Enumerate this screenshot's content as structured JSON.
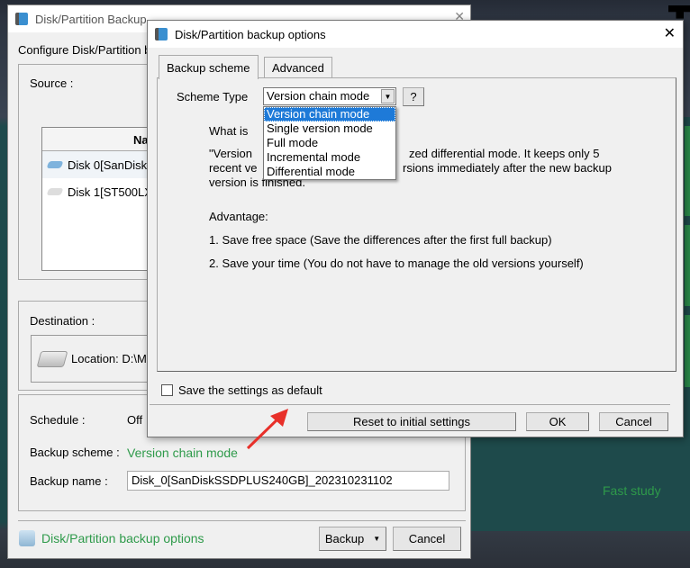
{
  "background": {
    "right_text": "Fast study"
  },
  "main_window": {
    "title": "Disk/Partition Backup",
    "configure_label": "Configure Disk/Partition b",
    "source_label": "Source :",
    "list_header": "Na",
    "disks": [
      {
        "name": "Disk 0[SanDisk",
        "icon": "ssd-icon",
        "color": "#7fb3dd"
      },
      {
        "name": "Disk 1[ST500LX",
        "icon": "hdd-icon",
        "color": "#dddddd"
      }
    ],
    "destination_label": "Destination :",
    "location_text": "Location: D:\\MC",
    "schedule_label": "Schedule :",
    "schedule_value": "Off",
    "scheme_label": "Backup scheme :",
    "scheme_value": "Version chain mode",
    "name_label": "Backup name :",
    "name_value": "Disk_0[SanDiskSSDPLUS240GB]_202310231102",
    "options_link": "Disk/Partition backup options",
    "backup_button": "Backup",
    "cancel_button": "Cancel"
  },
  "dialog": {
    "title": "Disk/Partition backup options",
    "tabs": [
      {
        "label": "Backup scheme"
      },
      {
        "label": "Advanced"
      }
    ],
    "scheme_type_label": "Scheme Type",
    "scheme_selected": "Version chain mode",
    "help_button": "?",
    "options": [
      "Version chain mode",
      "Single version mode",
      "Full mode",
      "Incremental mode",
      "Differential mode"
    ],
    "what_is": "What is",
    "desc_line1a": "\"Version",
    "desc_line1b": "zed differential mode. It keeps only 5",
    "desc_line2a": "recent ve",
    "desc_line2b": "rsions immediately after the new backup",
    "desc_line3": "version is finished.",
    "advantage_label": "Advantage:",
    "advantage_1": "1. Save free space (Save the differences after the first full backup)",
    "advantage_2": "2. Save your time (You do not have to manage the old versions yourself)",
    "save_default_label": "Save the settings as default",
    "save_default_checked": false,
    "reset_button": "Reset to initial settings",
    "ok_button": "OK",
    "cancel_button": "Cancel"
  }
}
